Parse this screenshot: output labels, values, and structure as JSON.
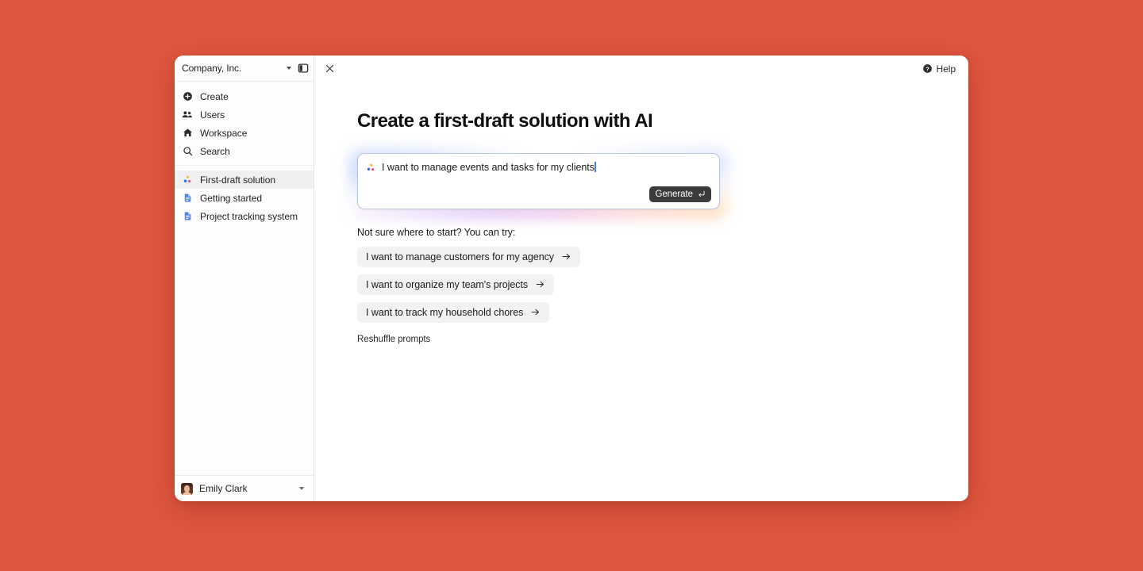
{
  "theme": {
    "desktop_background": "#e0563f",
    "window_background": "#ffffff",
    "sidebar_background": "#fdfdfd",
    "accent_border": "#b9c6de",
    "generate_button": "#3b3b3b",
    "chip_background": "#f2f2f2",
    "doc_icon_blue": "#4a86e8",
    "sparkle_yellow": "#f5bc42",
    "sparkle_blue": "#3b6ff0",
    "sparkle_pink": "#e0519e"
  },
  "sidebar": {
    "org_switcher": {
      "name": "Company, Inc.",
      "caret_icon": "chevron-down-icon",
      "panel_toggle_icon": "sidebar-toggle-icon"
    },
    "primary_nav": [
      {
        "label": "Create",
        "icon": "plus-circle-icon"
      },
      {
        "label": "Users",
        "icon": "people-icon"
      },
      {
        "label": "Workspace",
        "icon": "home-icon"
      },
      {
        "label": "Search",
        "icon": "search-icon"
      }
    ],
    "documents": [
      {
        "label": "First-draft solution",
        "icon": "sparkle-icon",
        "selected": true
      },
      {
        "label": "Getting started",
        "icon": "document-icon",
        "selected": false
      },
      {
        "label": "Project tracking system",
        "icon": "document-icon",
        "selected": false
      }
    ],
    "footer": {
      "user_name": "Emily Clark",
      "avatar_icon": "user-avatar-photo",
      "caret_icon": "chevron-down-icon"
    }
  },
  "topbar": {
    "close_icon": "close-icon",
    "help_label": "Help",
    "help_icon": "help-circle-icon"
  },
  "main": {
    "title": "Create a first-draft solution with AI",
    "prompt": {
      "value": "I want to manage events and tasks for my clients",
      "placeholder": "Describe what you want to build",
      "leading_icon": "sparkle-icon",
      "generate_label": "Generate",
      "generate_icon": "enter-return-icon"
    },
    "suggestions": {
      "heading": "Not sure where to start? You can try:",
      "chips": [
        {
          "label": "I want to manage customers for my agency",
          "icon": "arrow-right-icon"
        },
        {
          "label": "I want to organize my team's projects",
          "icon": "arrow-right-icon"
        },
        {
          "label": "I want to track my household chores",
          "icon": "arrow-right-icon"
        }
      ],
      "reshuffle_label": "Reshuffle prompts"
    }
  }
}
